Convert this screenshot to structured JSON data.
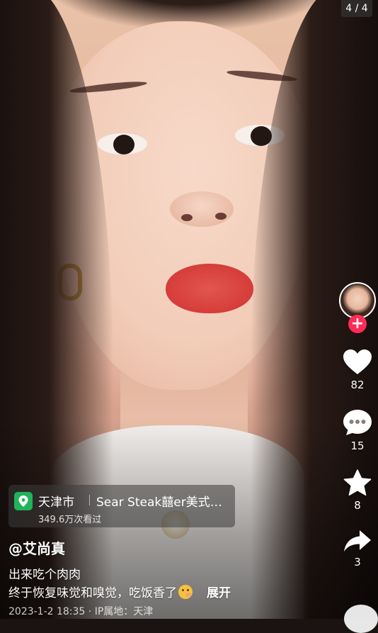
{
  "page_indicator": "4 / 4",
  "author": {
    "username": "@艾尚真"
  },
  "actions": {
    "likes": "82",
    "comments": "15",
    "favorites": "8",
    "shares": "3",
    "follow_symbol": "+"
  },
  "location": {
    "city": "天津市",
    "place": "Sear Steak囍er美式音…",
    "views": "349.6万次看过"
  },
  "caption": {
    "line1": "出来吃个肉肉",
    "line2": "终于恢复味觉和嗅觉，吃饭香了",
    "expand": "展开"
  },
  "meta": {
    "text": "2023-1-2 18:35 · IP属地：天津"
  },
  "icons": {
    "like": "heart-icon",
    "comment": "comment-icon",
    "favorite": "star-icon",
    "share": "share-icon",
    "location": "location-pin-icon"
  },
  "colors": {
    "follow": "#fe2c55",
    "location_pin": "#21b35a"
  }
}
